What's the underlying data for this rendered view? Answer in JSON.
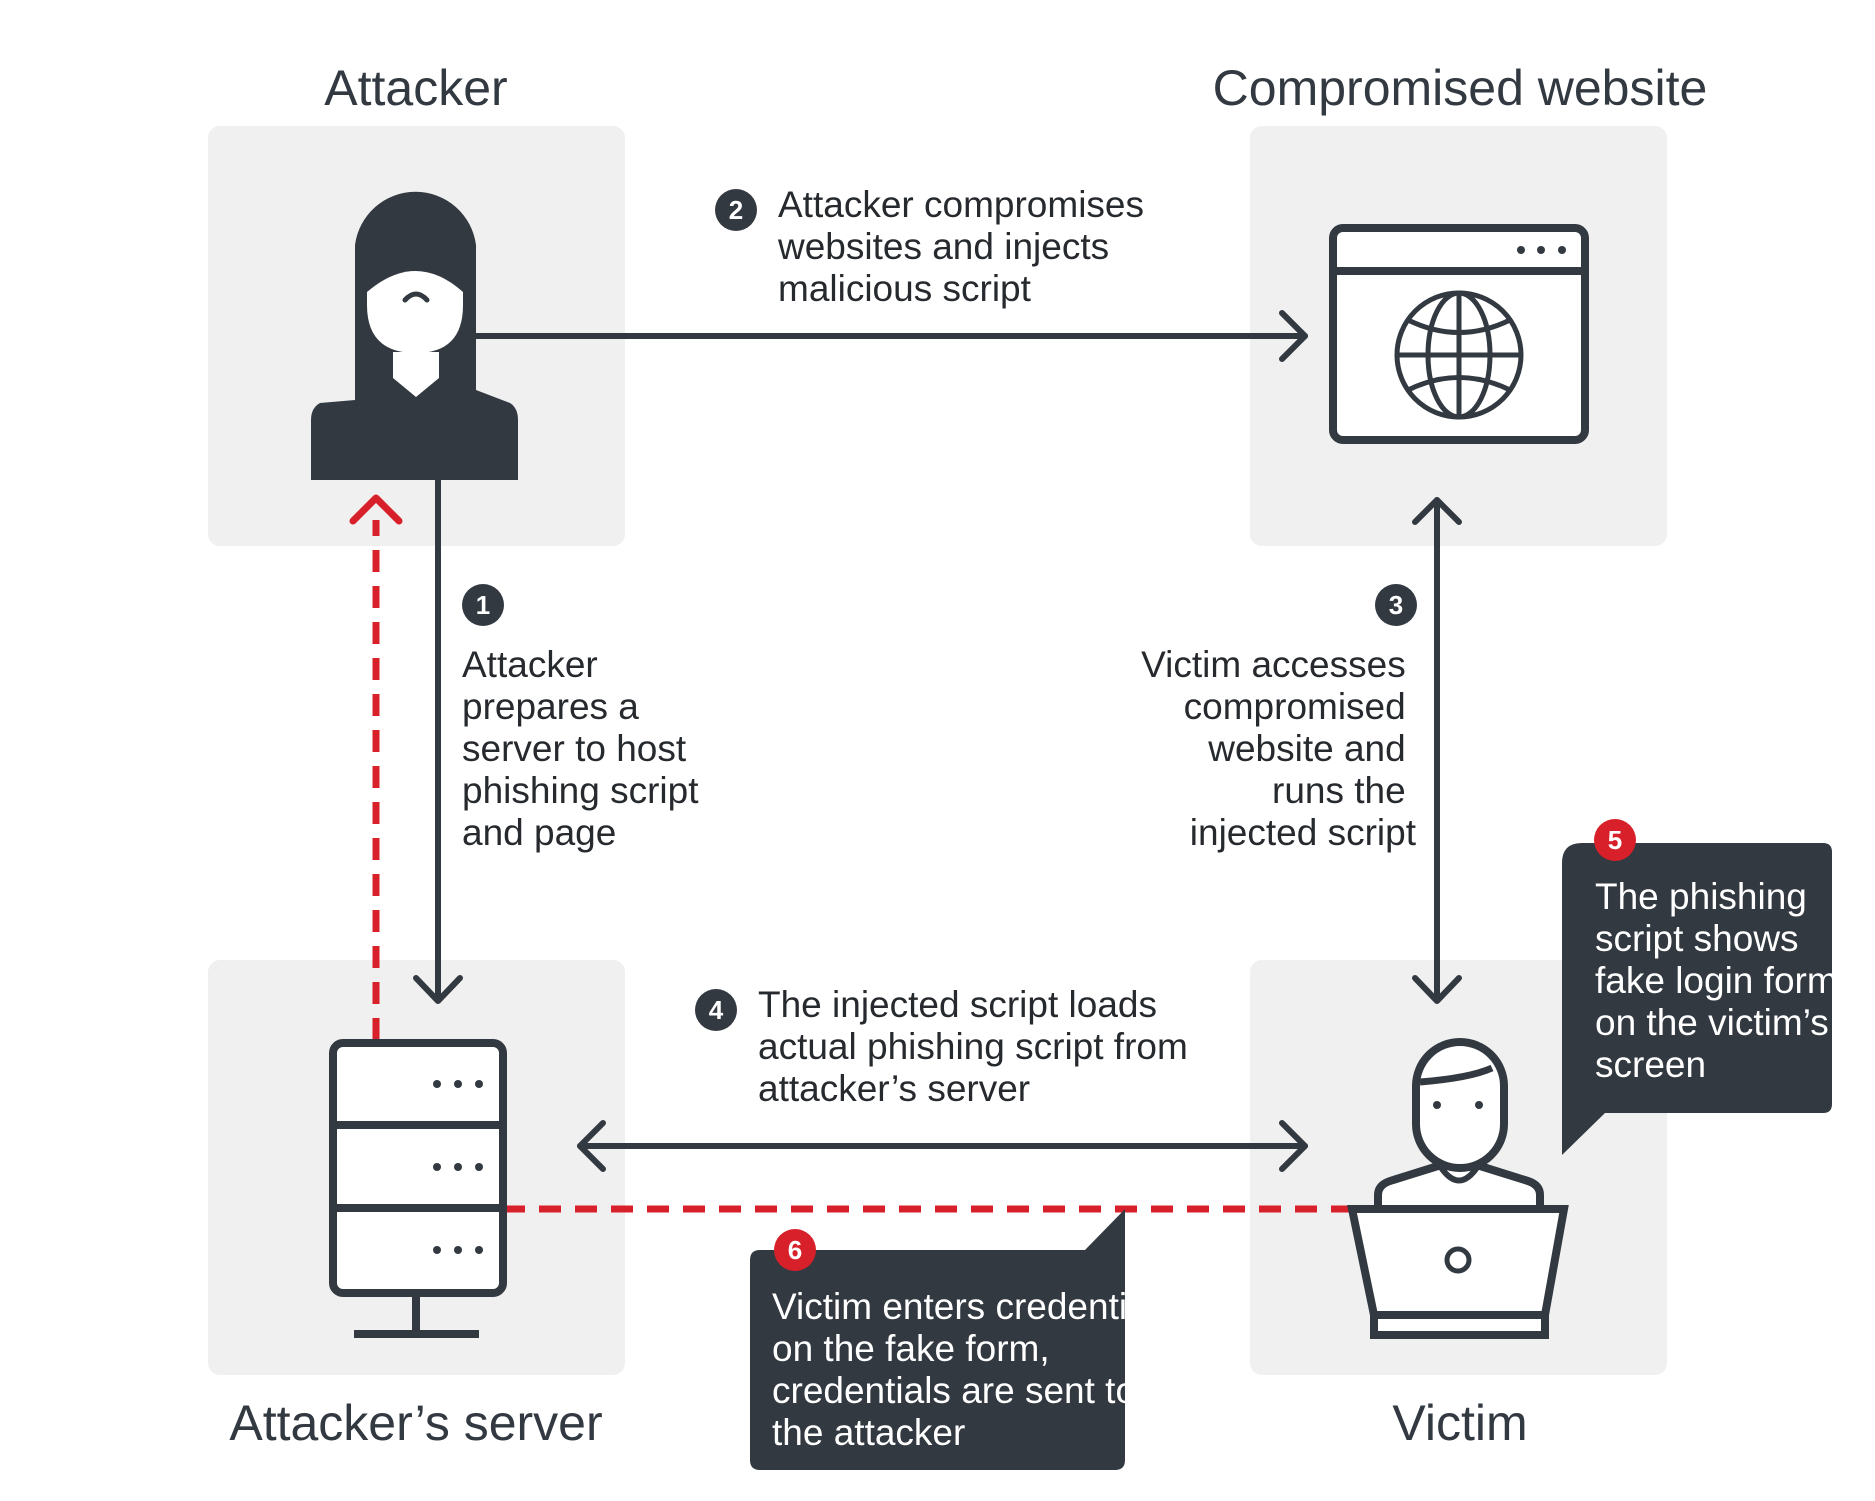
{
  "colors": {
    "dark": "#323941",
    "accent_red": "#d7202a",
    "panel_bg": "#f0f0f0",
    "text": "#26292d",
    "background": "#ffffff"
  },
  "nodes": {
    "attacker": {
      "title": "Attacker",
      "icon": "hooded-attacker-icon"
    },
    "compromised_website": {
      "title": "Compromised website",
      "icon": "browser-globe-icon"
    },
    "attackers_server": {
      "title": "Attacker’s server",
      "icon": "server-rack-icon"
    },
    "victim": {
      "title": "Victim",
      "icon": "person-laptop-icon"
    }
  },
  "steps": [
    {
      "number": "1",
      "lines": [
        "Attacker",
        "prepares a",
        "server to host",
        "phishing script",
        "and page"
      ],
      "badge_color": "dark"
    },
    {
      "number": "2",
      "lines": [
        "Attacker compromises",
        "websites and injects",
        "malicious script"
      ],
      "badge_color": "dark"
    },
    {
      "number": "3",
      "lines": [
        "Victim accesses",
        "compromised",
        "website and",
        "runs the",
        "injected script"
      ],
      "badge_color": "dark"
    },
    {
      "number": "4",
      "lines": [
        "The injected script loads",
        "actual phishing script from",
        "attacker’s server"
      ],
      "badge_color": "dark"
    },
    {
      "number": "5",
      "lines": [
        "The phishing",
        "script shows",
        "fake login form",
        "on the victim’s",
        "screen"
      ],
      "badge_color": "red"
    },
    {
      "number": "6",
      "lines": [
        "Victim enters credentials",
        "on the fake form,",
        "credentials are sent to",
        "the attacker"
      ],
      "badge_color": "red"
    }
  ],
  "connections": [
    {
      "from": "attacker",
      "to": "attackers_server",
      "style": "solid",
      "step": "1"
    },
    {
      "from": "attacker",
      "to": "compromised_website",
      "style": "solid",
      "step": "2"
    },
    {
      "from": "victim",
      "to": "compromised_website",
      "style": "solid-bidirectional",
      "step": "3"
    },
    {
      "from": "attackers_server",
      "to": "victim",
      "style": "solid-bidirectional",
      "step": "4"
    },
    {
      "from": "victim",
      "to": "attackers_server",
      "style": "dashed-red",
      "step": "6"
    },
    {
      "from": "attackers_server",
      "to": "attacker",
      "style": "dashed-red",
      "step": "6"
    }
  ]
}
